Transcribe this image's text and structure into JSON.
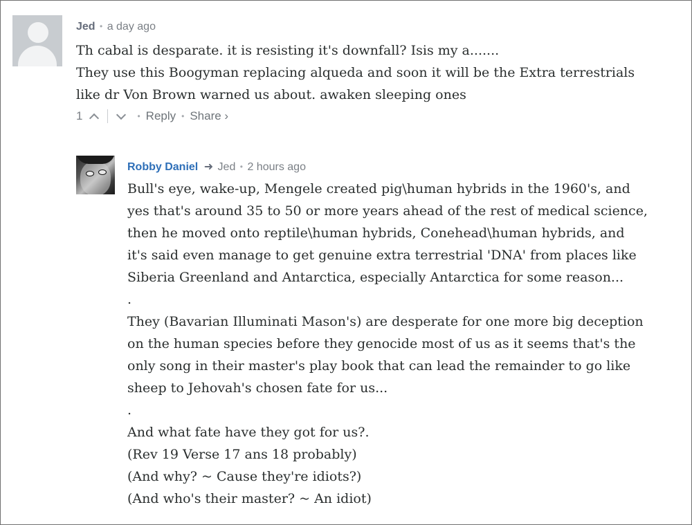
{
  "comments": [
    {
      "author": "Jed",
      "separator": "•",
      "timestamp": "a day ago",
      "lines": [
        "Th cabal is desparate. it is resisting it's downfall? Isis my a.......",
        "They use this Boogyman replacing alqueda and soon it will be the Extra terrestrials",
        "like dr Von Brown warned us about. awaken sleeping ones"
      ],
      "actions": {
        "vote_count": "1",
        "reply_label": "Reply",
        "share_label": "Share ›"
      }
    },
    {
      "author": "Robby Daniel",
      "reply_to": "Jed",
      "separator": "•",
      "timestamp": "2 hours ago",
      "lines": [
        "Bull's eye, wake-up, Mengele created pig\\human hybrids in the 1960's, and",
        "yes that's around 35 to 50 or more years ahead of the rest of medical science,",
        "then he moved onto reptile\\human hybrids, Conehead\\human hybrids, and",
        "it's said even manage to get genuine extra terrestrial 'DNA' from places like",
        "Siberia Greenland and Antarctica, especially Antarctica for some reason...",
        ".",
        "They (Bavarian Illuminati Mason's) are desperate for one more big deception",
        "on the human species before they genocide most of us as it seems that's the",
        "only song in their master's play book that can lead the remainder to go like",
        "sheep to Jehovah's chosen fate for us...",
        ".",
        "And what fate have they got for us?.",
        "(Rev 19 Verse 17 ans 18 probably)",
        "(And why? ~ Cause they're idiots?)",
        "(And who's their master? ~ An idiot)"
      ]
    }
  ],
  "icons": {
    "upvote": "chevron-up-icon",
    "downvote": "chevron-down-icon",
    "reply_arrow": "reply-arrow-icon"
  },
  "colors": {
    "author_link": "#2e6fb8",
    "meta_text": "#7a7f85",
    "body_text": "#2a2e2e"
  }
}
